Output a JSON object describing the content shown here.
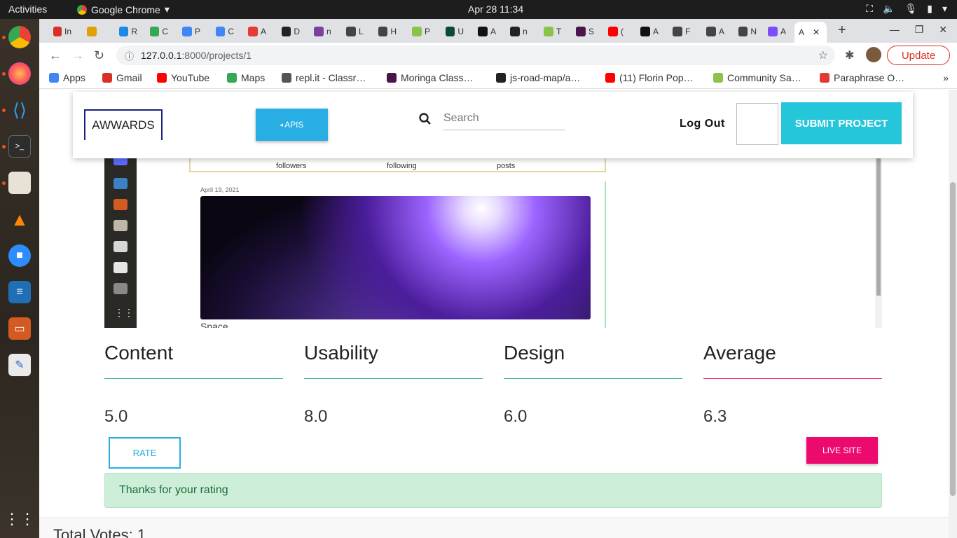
{
  "topbar": {
    "activities": "Activities",
    "app_name": "Google Chrome",
    "datetime": "Apr 28  11:34"
  },
  "tabs": [
    {
      "label": "In",
      "color": "#d93025"
    },
    {
      "label": "",
      "color": "#e0a000"
    },
    {
      "label": "R",
      "color": "#1e88e5"
    },
    {
      "label": "C",
      "color": "#34a853"
    },
    {
      "label": "P",
      "color": "#4285f4"
    },
    {
      "label": "C",
      "color": "#4285f4"
    },
    {
      "label": "A",
      "color": "#e53935"
    },
    {
      "label": "D",
      "color": "#222222"
    },
    {
      "label": "n",
      "color": "#7b3fa0"
    },
    {
      "label": "L",
      "color": "#444444"
    },
    {
      "label": "H",
      "color": "#444444"
    },
    {
      "label": "P",
      "color": "#8bc34a"
    },
    {
      "label": "U",
      "color": "#0c4b33"
    },
    {
      "label": "A",
      "color": "#111111"
    },
    {
      "label": "n",
      "color": "#222222"
    },
    {
      "label": "T",
      "color": "#8bc34a"
    },
    {
      "label": "S",
      "color": "#4a154b"
    },
    {
      "label": "(",
      "color": "#ff0000"
    },
    {
      "label": "A",
      "color": "#111111"
    },
    {
      "label": "F",
      "color": "#444444"
    },
    {
      "label": "A",
      "color": "#444444"
    },
    {
      "label": "N",
      "color": "#444444"
    },
    {
      "label": "A",
      "color": "#7c4dff"
    }
  ],
  "active_tab": {
    "label": "A"
  },
  "address": {
    "host": "127.0.0.1",
    "path": ":8000/projects/1",
    "update_label": "Update"
  },
  "bookmarks": [
    {
      "label": "Apps",
      "color": "#4285f4"
    },
    {
      "label": "Gmail",
      "color": "#d93025"
    },
    {
      "label": "YouTube",
      "color": "#ff0000"
    },
    {
      "label": "Maps",
      "color": "#34a853"
    },
    {
      "label": "repl.it - Classr…",
      "color": "#555555"
    },
    {
      "label": "Moringa Class…",
      "color": "#4a154b"
    },
    {
      "label": "js-road-map/a…",
      "color": "#222222"
    },
    {
      "label": "(11) Florin Pop…",
      "color": "#ff0000"
    },
    {
      "label": "Community Sa…",
      "color": "#8bc34a"
    },
    {
      "label": "Paraphrase O…",
      "color": "#e53935"
    }
  ],
  "navbar": {
    "logo": "AWWARDS",
    "apis_label": "APIS",
    "search_placeholder": "Search",
    "logout_label": "Log Out",
    "submit_label": "SUBMIT PROJECT"
  },
  "profile_stats": {
    "followers": "followers",
    "following": "following",
    "posts": "posts"
  },
  "post": {
    "date": "April 19, 2021",
    "title": "Space"
  },
  "ratings": [
    {
      "label": "Content",
      "value": "5.0",
      "line_color": "#26a69a"
    },
    {
      "label": "Usability",
      "value": "8.0",
      "line_color": "#26a69a"
    },
    {
      "label": "Design",
      "value": "6.0",
      "line_color": "#26a69a"
    },
    {
      "label": "Average",
      "value": "6.3",
      "line_color": "#ec0a6f"
    }
  ],
  "actions": {
    "rate_label": "RATE",
    "live_label": "LIVE SITE"
  },
  "alert": {
    "message": "Thanks for your rating"
  },
  "votes": {
    "text": "Total Votes: 1"
  },
  "colors": {
    "accent_blue": "#29aee4",
    "accent_cyan": "#26c6da",
    "accent_pink": "#ec0a6f",
    "success_bg": "#cdeed8"
  }
}
